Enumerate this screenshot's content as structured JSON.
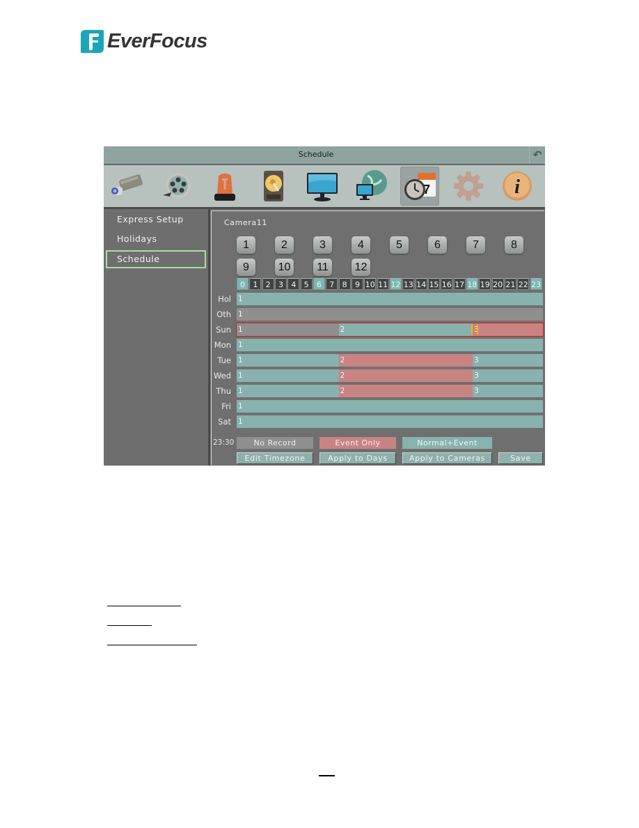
{
  "document": {
    "brand": "EverFocus",
    "page_number_blank": true,
    "underlined_terms_count": 3
  },
  "window": {
    "title": "Schedule",
    "back_icon": "back-arrow-icon"
  },
  "toolbar": {
    "items": [
      {
        "id": "camera",
        "icon": "camera-icon"
      },
      {
        "id": "record",
        "icon": "film-reel-icon"
      },
      {
        "id": "alarm",
        "icon": "alarm-siren-icon"
      },
      {
        "id": "storage",
        "icon": "hard-disk-icon"
      },
      {
        "id": "display",
        "icon": "monitor-icon"
      },
      {
        "id": "network",
        "icon": "network-globe-icon"
      },
      {
        "id": "schedule",
        "icon": "clock-calendar-icon",
        "active": true,
        "calendar_day": "7"
      },
      {
        "id": "system",
        "icon": "gear-icon"
      },
      {
        "id": "information",
        "icon": "info-icon"
      }
    ]
  },
  "sidebar": {
    "items": [
      {
        "label": "Express Setup"
      },
      {
        "label": "Holidays"
      },
      {
        "label": "Schedule",
        "active": true
      }
    ]
  },
  "main": {
    "camera_label": "Camera11",
    "camera_buttons": [
      "1",
      "2",
      "3",
      "4",
      "5",
      "6",
      "7",
      "8",
      "9",
      "10",
      "11",
      "12"
    ],
    "hours": [
      "0",
      "1",
      "2",
      "3",
      "4",
      "5",
      "6",
      "7",
      "8",
      "9",
      "10",
      "11",
      "12",
      "13",
      "14",
      "15",
      "16",
      "17",
      "18",
      "19",
      "20",
      "21",
      "22",
      "23"
    ],
    "highlighted_hours": [
      "0",
      "6",
      "12",
      "18",
      "23"
    ],
    "modes": {
      "no_record": {
        "label": "No Record",
        "color": "#8f8f8f"
      },
      "event_only": {
        "label": "Event Only",
        "color": "#c98383"
      },
      "normal_event": {
        "label": "Normal+Event",
        "color": "#88b2ae"
      }
    },
    "days": [
      {
        "label": "Hol",
        "segments": [
          {
            "num": "1",
            "start": 0,
            "end": 24,
            "mode": "normal_event"
          }
        ]
      },
      {
        "label": "Oth",
        "segments": [
          {
            "num": "1",
            "start": 0,
            "end": 24,
            "mode": "no_record"
          }
        ]
      },
      {
        "label": "Sun",
        "selected": true,
        "cursor_hour": 18.5,
        "segments": [
          {
            "num": "1",
            "start": 0,
            "end": 8,
            "mode": "no_record"
          },
          {
            "num": "2",
            "start": 8,
            "end": 18.5,
            "mode": "normal_event"
          },
          {
            "num": "3",
            "start": 18.5,
            "end": 24,
            "mode": "event_only"
          }
        ]
      },
      {
        "label": "Mon",
        "segments": [
          {
            "num": "1",
            "start": 0,
            "end": 24,
            "mode": "normal_event"
          }
        ]
      },
      {
        "label": "Tue",
        "segments": [
          {
            "num": "1",
            "start": 0,
            "end": 8,
            "mode": "normal_event"
          },
          {
            "num": "2",
            "start": 8,
            "end": 18.5,
            "mode": "event_only"
          },
          {
            "num": "3",
            "start": 18.5,
            "end": 24,
            "mode": "normal_event"
          }
        ]
      },
      {
        "label": "Wed",
        "segments": [
          {
            "num": "1",
            "start": 0,
            "end": 8,
            "mode": "normal_event"
          },
          {
            "num": "2",
            "start": 8,
            "end": 18.5,
            "mode": "event_only"
          },
          {
            "num": "3",
            "start": 18.5,
            "end": 24,
            "mode": "normal_event"
          }
        ]
      },
      {
        "label": "Thu",
        "segments": [
          {
            "num": "1",
            "start": 0,
            "end": 8,
            "mode": "normal_event"
          },
          {
            "num": "2",
            "start": 8,
            "end": 18.5,
            "mode": "event_only"
          },
          {
            "num": "3",
            "start": 18.5,
            "end": 24,
            "mode": "normal_event"
          }
        ]
      },
      {
        "label": "Fri",
        "segments": [
          {
            "num": "1",
            "start": 0,
            "end": 24,
            "mode": "normal_event"
          }
        ]
      },
      {
        "label": "Sat",
        "segments": [
          {
            "num": "1",
            "start": 0,
            "end": 24,
            "mode": "normal_event"
          }
        ]
      }
    ],
    "time_readout": "23:30",
    "legend": {
      "no_record": "No Record",
      "event_only": "Event Only",
      "normal_event": "Normal+Event"
    },
    "actions": {
      "edit_timezone": "Edit Timezone",
      "apply_days": "Apply to Days",
      "apply_cameras": "Apply to Cameras",
      "save": "Save"
    }
  }
}
